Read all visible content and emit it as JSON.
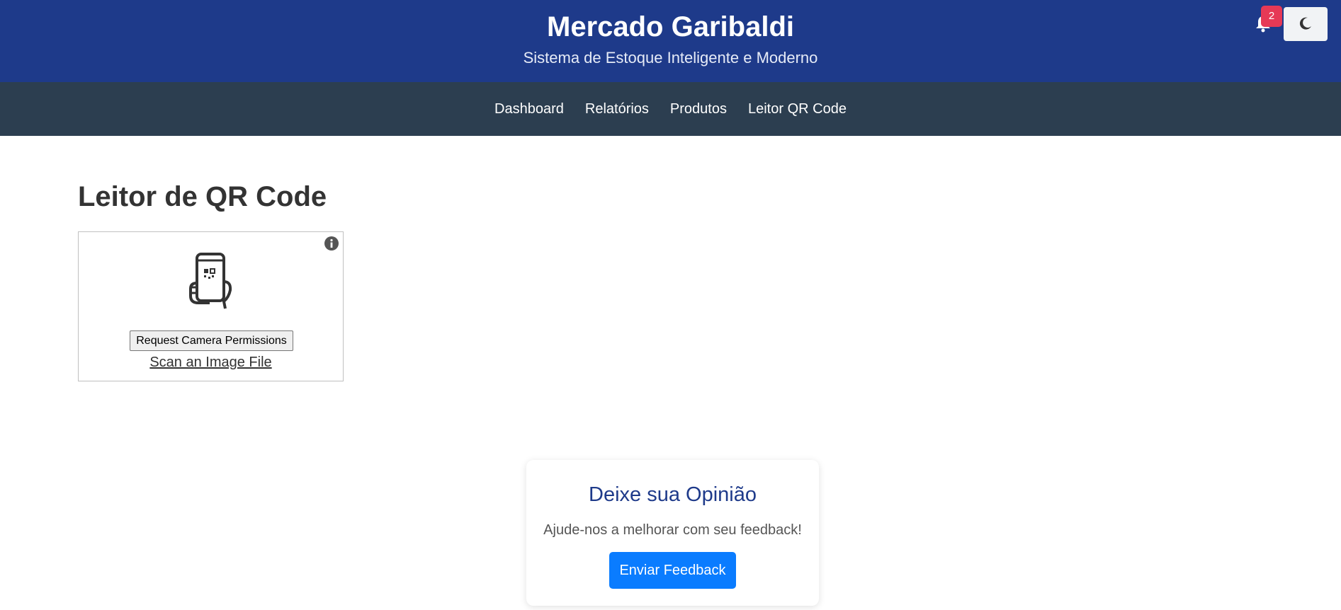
{
  "header": {
    "title": "Mercado Garibaldi",
    "subtitle": "Sistema de Estoque Inteligente e Moderno",
    "notification_count": "2",
    "notification_icon": "bell-icon",
    "theme_icon": "moon-icon"
  },
  "nav": {
    "items": [
      {
        "label": "Dashboard"
      },
      {
        "label": "Relatórios"
      },
      {
        "label": "Produtos"
      },
      {
        "label": "Leitor QR Code"
      }
    ]
  },
  "main": {
    "page_title": "Leitor de QR Code",
    "scanner": {
      "camera_button": "Request Camera Permissions",
      "scan_file_link": "Scan an Image File",
      "info_icon": "info-icon",
      "illustration_icon": "phone-qr-icon"
    }
  },
  "feedback": {
    "title": "Deixe sua Opinião",
    "text": "Ajude-nos a melhorar com seu feedback!",
    "button": "Enviar Feedback"
  },
  "colors": {
    "header_bg": "#1e3a8a",
    "navbar_bg": "#2c3e50",
    "badge": "#e63956",
    "primary_button": "#0a7cff"
  }
}
